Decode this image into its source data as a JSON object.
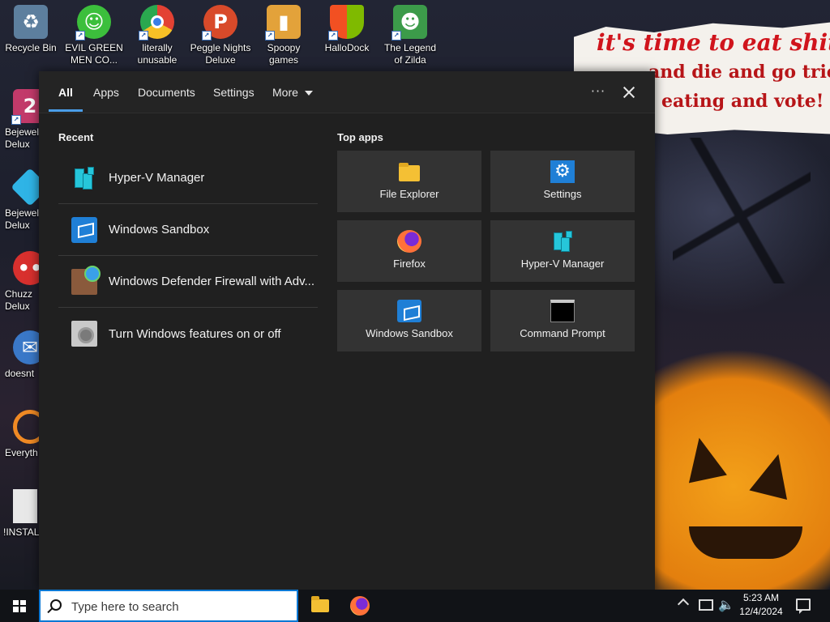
{
  "wallpaper": {
    "poster_line1": "it's time to eat shit",
    "poster_line2": "and die and go trick",
    "poster_line3": "eating and vote!"
  },
  "desktop_icons": [
    {
      "label": "Recycle Bin",
      "icon": "recycle-bin-icon",
      "color": "#8fb6d8"
    },
    {
      "label": "EVIL GREEN MEN CO...",
      "icon": "messenger-icon",
      "color": "#3cbf3c"
    },
    {
      "label": "literally unusable",
      "icon": "chrome-icon",
      "color": "#e34133"
    },
    {
      "label": "Peggle Nights Deluxe",
      "icon": "peggle-icon",
      "color": "#d84a2a"
    },
    {
      "label": "Spoopy games",
      "icon": "folder-icon",
      "color": "#e3a23a"
    },
    {
      "label": "HalloDock",
      "icon": "windows-shield-icon",
      "color": "#f25022"
    },
    {
      "label": "The Legend of Zilda",
      "icon": "zilda-icon",
      "color": "#3c9b4a"
    }
  ],
  "desktop_left_icons": [
    {
      "label": "Bejewel Delux",
      "icon": "bejeweled-icon",
      "color": "#c23a6a"
    },
    {
      "label": "Bejewel Delux",
      "icon": "bejeweled-gem-icon",
      "color": "#2fb4e6"
    },
    {
      "label": "Chuzz Delux",
      "icon": "chuzzle-icon",
      "color": "#d8302e"
    },
    {
      "label": "doesnt",
      "icon": "thunderbird-icon",
      "color": "#3a78c8"
    },
    {
      "label": "Everyth",
      "icon": "everything-search-icon",
      "color": "#f08a24"
    },
    {
      "label": "!INSTALL",
      "icon": "text-file-icon",
      "color": "#e8e8e8"
    }
  ],
  "flyout": {
    "tabs": [
      {
        "label": "All",
        "active": true
      },
      {
        "label": "Apps",
        "active": false
      },
      {
        "label": "Documents",
        "active": false
      },
      {
        "label": "Settings",
        "active": false
      },
      {
        "label": "More",
        "active": false
      }
    ],
    "more_options_label": "···",
    "recent_title": "Recent",
    "recent": [
      {
        "label": "Hyper-V Manager",
        "icon": "hyper-v-icon"
      },
      {
        "label": "Windows Sandbox",
        "icon": "sandbox-icon"
      },
      {
        "label": "Windows Defender Firewall with Adv...",
        "icon": "firewall-icon"
      },
      {
        "label": "Turn Windows features on or off",
        "icon": "windows-features-icon"
      }
    ],
    "top_apps_title": "Top apps",
    "top_apps": [
      {
        "label": "File Explorer",
        "icon": "file-explorer-icon"
      },
      {
        "label": "Settings",
        "icon": "settings-gear-icon"
      },
      {
        "label": "Firefox",
        "icon": "firefox-icon"
      },
      {
        "label": "Hyper-V Manager",
        "icon": "hyper-v-icon"
      },
      {
        "label": "Windows Sandbox",
        "icon": "sandbox-icon"
      },
      {
        "label": "Command Prompt",
        "icon": "command-prompt-icon"
      }
    ]
  },
  "taskbar": {
    "search_placeholder": "Type here to search",
    "time": "5:23 AM",
    "date": "12/4/2024",
    "accent": "#0a78d4"
  }
}
